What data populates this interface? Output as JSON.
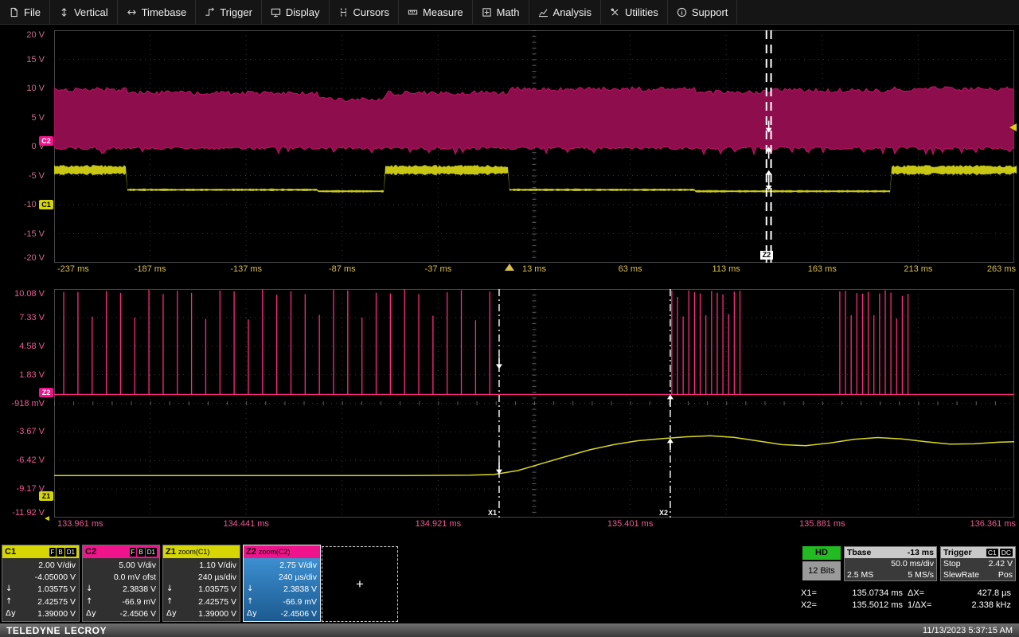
{
  "menu": {
    "items": [
      {
        "label": "File"
      },
      {
        "label": "Vertical"
      },
      {
        "label": "Timebase"
      },
      {
        "label": "Trigger"
      },
      {
        "label": "Display"
      },
      {
        "label": "Cursors"
      },
      {
        "label": "Measure"
      },
      {
        "label": "Math"
      },
      {
        "label": "Analysis"
      },
      {
        "label": "Utilities"
      },
      {
        "label": "Support"
      }
    ]
  },
  "colors": {
    "c1_yellow": "#d6d600",
    "c2_pink": "#f0148c",
    "c2_band": "#8e0d4c",
    "z2_spike": "#ff2a7f",
    "cursor_white": "#ffffff",
    "hd_green": "#22bb22",
    "main_axis_yellow": "#d9c04a",
    "zoom_axis_pink": "#ef5a95",
    "selected_body_blue": "#2b7fc0"
  },
  "top_grid": {
    "y_labels": [
      "20 V",
      "15 V",
      "10 V",
      "5 V",
      "0 V",
      "-5 V",
      "-10 V",
      "-15 V",
      "-20 V"
    ],
    "x_labels": [
      "-237 ms",
      "-187 ms",
      "-137 ms",
      "-87 ms",
      "-37 ms",
      "13 ms",
      "63 ms",
      "113 ms",
      "163 ms",
      "213 ms",
      "263 ms"
    ],
    "c2_tag": "C2",
    "c1_tag": "C1",
    "zoom_region_label": "Z2"
  },
  "zoom_grid": {
    "y_labels": [
      "10.08 V",
      "7.33 V",
      "4.58 V",
      "1.83 V",
      "-918 mV",
      "-3.67 V",
      "-6.42 V",
      "-9.17 V",
      "-11.92 V"
    ],
    "x_labels": [
      "133.961 ms",
      "134.441 ms",
      "134.921 ms",
      "135.401 ms",
      "135.881 ms",
      "136.361 ms"
    ],
    "z2_tag": "Z2",
    "z1_tag": "Z1",
    "cursor1_label": "X1",
    "cursor2_label": "X2",
    "offset_arrow": "◄"
  },
  "glyphs": {
    "down": "↓",
    "up": "↑",
    "dy": "Δy",
    "plus": "+"
  },
  "descriptors": [
    {
      "name": "C1",
      "badges": [
        "F",
        "B",
        "D1"
      ],
      "line1": "2.00 V/div",
      "line2": "-4.05000 V",
      "cursor_down": "1.03575 V",
      "cursor_up": "2.42575 V",
      "delta": "1.39000 V"
    },
    {
      "name": "C2",
      "badges": [
        "F",
        "B",
        "D1"
      ],
      "line1": "5.00 V/div",
      "line2": "0.0 mV ofst",
      "cursor_down": "2.3838 V",
      "cursor_up": "-66.9 mV",
      "delta": "-2.4506 V"
    },
    {
      "name": "Z1",
      "sub": "zoom(C1)",
      "line1": "1.10 V/div",
      "line2": "240 µs/div",
      "cursor_down": "1.03575 V",
      "cursor_up": "2.42575 V",
      "delta": "1.39000 V"
    },
    {
      "name": "Z2",
      "sub": "zoom(C2)",
      "line1": "2.75 V/div",
      "line2": "240 µs/div",
      "cursor_down": "2.3838 V",
      "cursor_up": "-66.9 mV",
      "delta": "-2.4506 V"
    }
  ],
  "right_panel": {
    "hd_label": "HD",
    "bits_label": "12 Bits",
    "tbase": {
      "title": "Tbase",
      "delay": "-13 ms",
      "scale": "50.0 ms/div",
      "samples": "2.5 MS",
      "rate": "5 MS/s"
    },
    "trigger": {
      "title": "Trigger",
      "source_badge": "C1",
      "coupling_badge": "DC",
      "mode": "Stop",
      "level": "2.42 V",
      "type": "SlewRate",
      "slope": "Pos"
    },
    "cursor_readout": {
      "x1_label": "X1=",
      "x1_value": "135.0734 ms",
      "dx_label": "ΔX=",
      "dx_value": "427.8 µs",
      "x2_label": "X2=",
      "x2_value": "135.5012 ms",
      "inv_label": "1/ΔX=",
      "inv_value": "2.338 kHz"
    }
  },
  "status_bar": {
    "brand_teledyne": "TELEDYNE",
    "brand_lecroy": "LECROY",
    "datetime": "11/13/2023 5:37:15 AM"
  },
  "chart_data": [
    {
      "id": "main-grid",
      "type": "mixed",
      "x_unit": "ms",
      "x_range": [
        -237,
        263
      ],
      "x_divisions": 10,
      "y_divisions": 8,
      "series": [
        {
          "name": "C2",
          "kind": "noise_band",
          "color": "#8e0d4c",
          "edge_color": "#c01462",
          "vdiv_V": 5.0,
          "center_V": 0.0,
          "bottom_V": 0.0,
          "top_steps": [
            [
              -237,
              9.8
            ],
            [
              -199,
              9.2
            ],
            [
              -100,
              8.1
            ],
            [
              -65,
              9.2
            ],
            [
              0,
              9.9
            ],
            [
              97,
              9.3
            ],
            [
              133,
              9.6
            ],
            [
              199,
              9.9
            ],
            [
              263,
              9.9
            ]
          ]
        },
        {
          "name": "C1",
          "kind": "step_line",
          "color": "#c8c814",
          "vdiv_V": 2.0,
          "center_V": 4.05,
          "noisy_level_threshold": 2.0,
          "steps": [
            [
              -237,
              2.43
            ],
            [
              -199,
              1.07
            ],
            [
              -100,
              0.97
            ],
            [
              -65,
              2.43
            ],
            [
              0,
              1.07
            ],
            [
              97,
              0.97
            ],
            [
              199,
              2.43
            ],
            [
              263,
              2.43
            ]
          ]
        }
      ],
      "zoom_region": {
        "label": "Z2",
        "t_start": 133.961,
        "t_end": 136.361
      },
      "trigger_time_ms": 0,
      "cursor_markers": [
        {
          "trace": "C2",
          "V": 2.3838,
          "dir": "down"
        },
        {
          "trace": "C2",
          "V": -0.0669,
          "dir": "up"
        },
        {
          "trace": "C1",
          "V": 2.42575,
          "dir": "up"
        },
        {
          "trace": "C1",
          "V": 1.03575,
          "dir": "down"
        }
      ]
    },
    {
      "id": "zoom-grid",
      "type": "mixed",
      "x_unit": "ms",
      "x_range": [
        133.961,
        136.361
      ],
      "x_divisions": 10,
      "y_divisions": 8,
      "series": [
        {
          "name": "Z2",
          "kind": "spikes",
          "color": "#ff2a7f",
          "vdiv_V": 2.75,
          "center_V": -0.918,
          "baseline_V": -0.0669,
          "spike_groups": [
            {
              "start_ms": 133.985,
              "step_ms": 0.0355,
              "count": 31,
              "peak_cycle_V": [
                9.9,
                9.7,
                7.4,
                9.9,
                9.8,
                7.2,
                9.9,
                9.6
              ]
            },
            {
              "start_ms": 135.505,
              "step_ms": 0.0142,
              "count": 13,
              "peak_cycle_V": [
                9.9,
                9.5,
                7.5,
                9.8
              ]
            },
            {
              "start_ms": 135.925,
              "step_ms": 0.0142,
              "count": 13,
              "peak_cycle_V": [
                9.8,
                9.9,
                7.4,
                9.6
              ]
            }
          ]
        },
        {
          "name": "Z1",
          "kind": "curve",
          "color": "#d8d820",
          "vdiv_V": 1.1,
          "center_V": 3.77,
          "points": [
            [
              133.961,
              0.99
            ],
            [
              134.5,
              0.99
            ],
            [
              134.85,
              0.99
            ],
            [
              135.0,
              1.0
            ],
            [
              135.06,
              1.03
            ],
            [
              135.12,
              1.18
            ],
            [
              135.18,
              1.45
            ],
            [
              135.24,
              1.72
            ],
            [
              135.3,
              1.98
            ],
            [
              135.36,
              2.18
            ],
            [
              135.42,
              2.33
            ],
            [
              135.48,
              2.41
            ],
            [
              135.54,
              2.48
            ],
            [
              135.6,
              2.52
            ],
            [
              135.66,
              2.46
            ],
            [
              135.72,
              2.32
            ],
            [
              135.78,
              2.18
            ],
            [
              135.84,
              2.14
            ],
            [
              135.9,
              2.24
            ],
            [
              135.96,
              2.38
            ],
            [
              136.02,
              2.45
            ],
            [
              136.08,
              2.4
            ],
            [
              136.14,
              2.29
            ],
            [
              136.2,
              2.2
            ],
            [
              136.26,
              2.21
            ],
            [
              136.32,
              2.27
            ],
            [
              136.361,
              2.29
            ]
          ]
        }
      ],
      "cursors": {
        "x1_ms": 135.0734,
        "x2_ms": 135.5012,
        "x1_markers_V": {
          "z2": 2.3838,
          "z1": 1.03575
        },
        "x2_markers_V": {
          "z2": -0.0669,
          "z1": 2.42575
        }
      }
    }
  ]
}
